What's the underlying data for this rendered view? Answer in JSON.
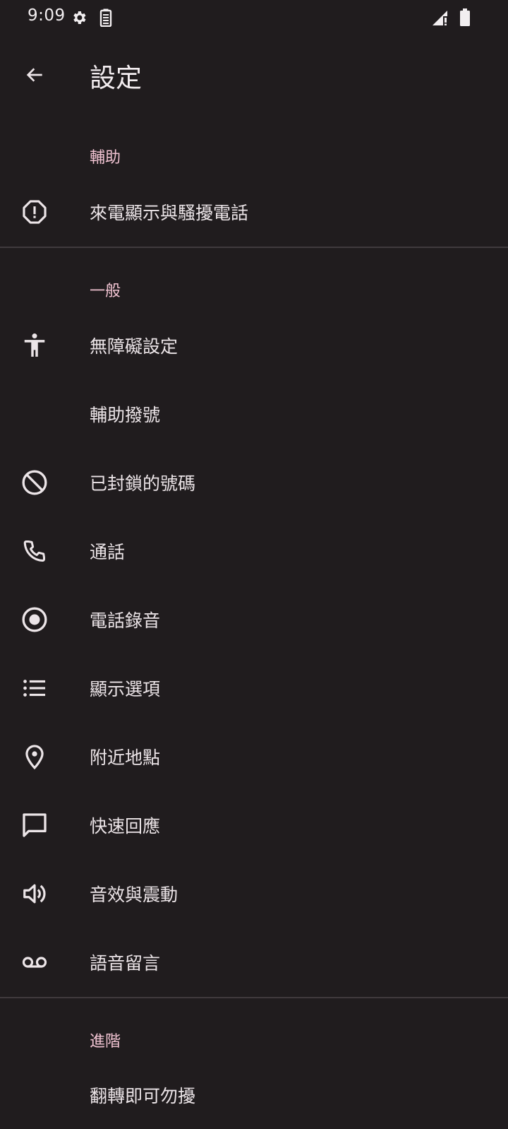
{
  "status": {
    "time": "9:09",
    "icons": [
      "gear-icon",
      "battery-saver-icon",
      "signal-alert-icon",
      "battery-icon"
    ]
  },
  "appbar": {
    "title": "設定",
    "back_icon": "arrow-back-icon"
  },
  "sections": {
    "assist": {
      "header": "輔助",
      "items": [
        {
          "label": "來電顯示與騷擾電話",
          "icon": "alert-circle-icon"
        }
      ]
    },
    "general": {
      "header": "一般",
      "items": [
        {
          "label": "無障礙設定",
          "icon": "accessibility-icon"
        },
        {
          "label": "輔助撥號",
          "icon": ""
        },
        {
          "label": "已封鎖的號碼",
          "icon": "block-icon"
        },
        {
          "label": "通話",
          "icon": "phone-icon"
        },
        {
          "label": "電話錄音",
          "icon": "record-icon"
        },
        {
          "label": "顯示選項",
          "icon": "list-icon"
        },
        {
          "label": "附近地點",
          "icon": "location-pin-icon"
        },
        {
          "label": "快速回應",
          "icon": "chat-bubble-icon"
        },
        {
          "label": "音效與震動",
          "icon": "volume-icon"
        },
        {
          "label": "語音留言",
          "icon": "voicemail-icon"
        }
      ]
    },
    "advanced": {
      "header": "進階",
      "items": [
        {
          "label": "翻轉即可勿擾",
          "icon": ""
        }
      ]
    }
  },
  "colors": {
    "background": "#201c1e",
    "section_header": "#f1c3d2",
    "text": "#ece5e8",
    "divider": "#403a3d"
  }
}
